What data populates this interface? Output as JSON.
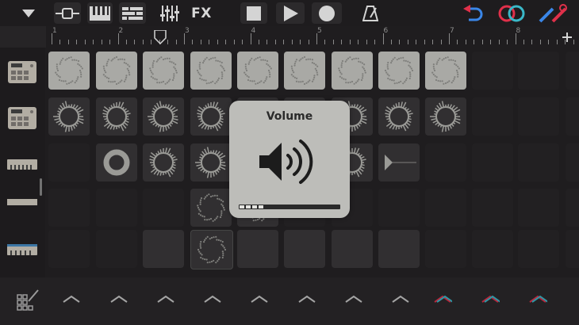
{
  "toolbar": {
    "fx_label": "FX",
    "icons": [
      "menu-triangle-icon",
      "tracks-view-icon",
      "keyboard-icon",
      "mixer-list-icon",
      "eq-sliders-icon",
      "stop-icon",
      "play-icon",
      "record-icon",
      "metronome-icon",
      "undo-icon",
      "loop-icon",
      "settings-wrench-icon"
    ],
    "colors": {
      "accent_red": "#e0304a",
      "icon_gray": "#d4d4d4"
    }
  },
  "ruler": {
    "bar_numbers": [
      "1",
      "2",
      "3",
      "4",
      "5",
      "6",
      "7",
      "8"
    ]
  },
  "tracks": [
    "drum-machine-icon",
    "drum-machine-icon",
    "keys-instrument-icon",
    "keys-instrument-icon",
    "keys-instrument-icon"
  ],
  "volume_hud": {
    "title": "Volume",
    "level": 0.27
  },
  "footer": {
    "edit_icon": "grid-edit-icon"
  }
}
